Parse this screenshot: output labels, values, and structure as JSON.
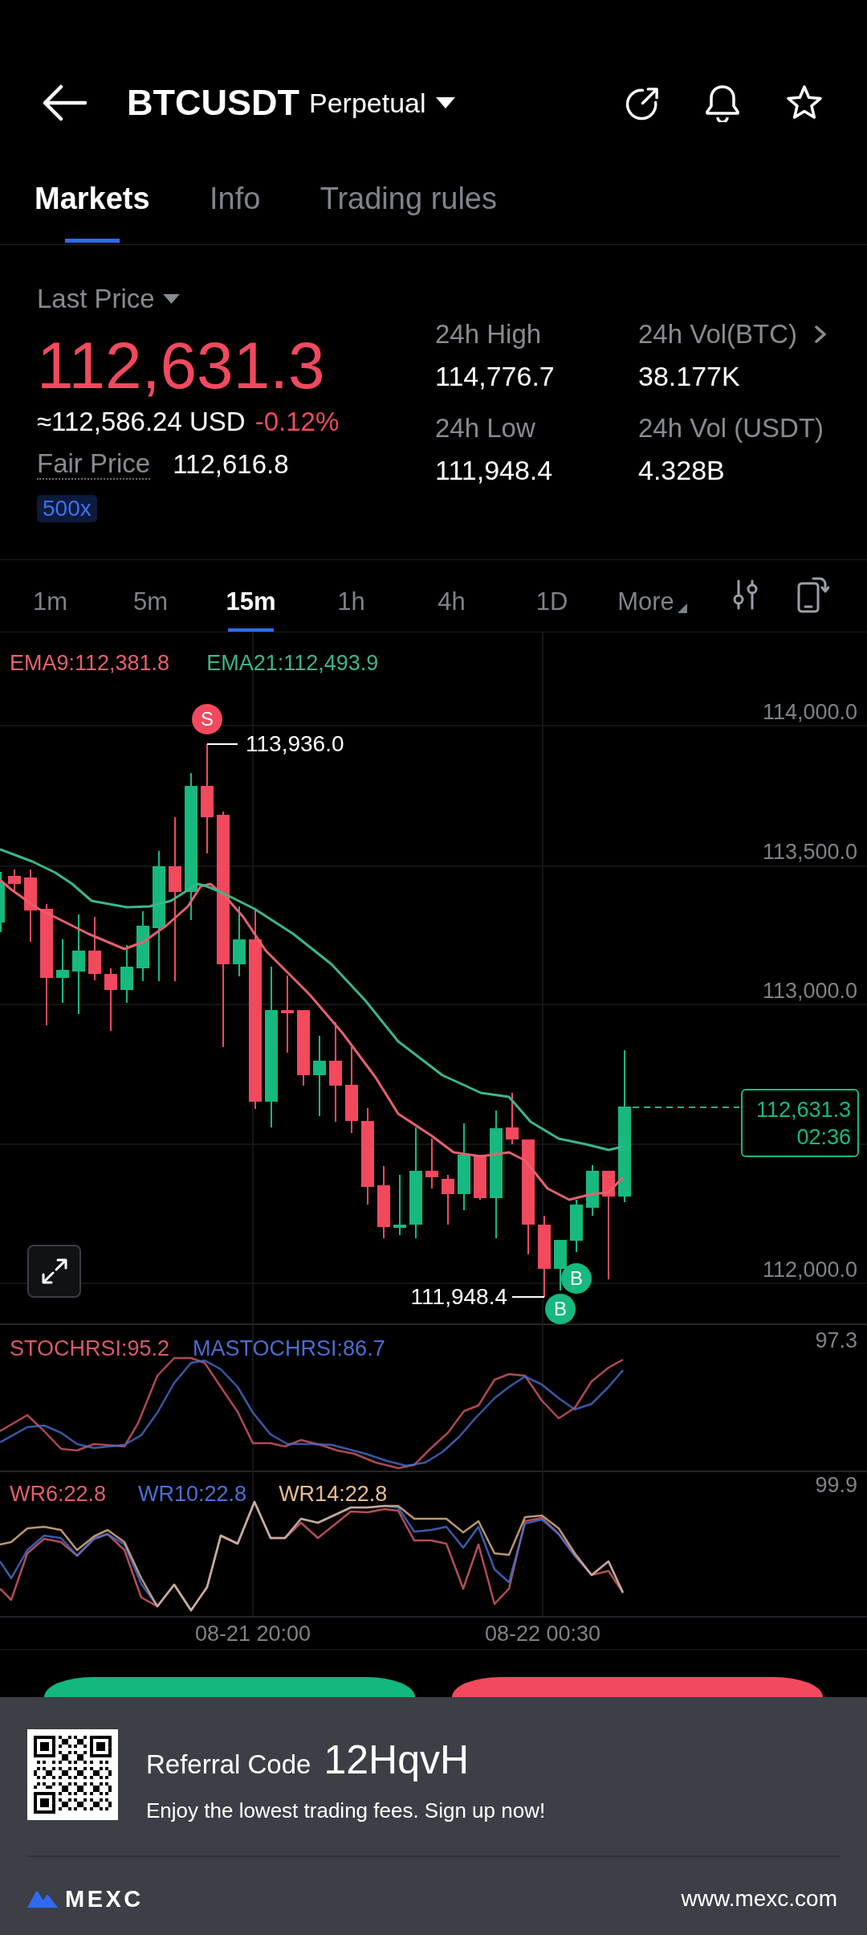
{
  "header": {
    "symbol": "BTCUSDT",
    "contract_type": "Perpetual"
  },
  "tabs": [
    {
      "label": "Markets",
      "selected": true
    },
    {
      "label": "Info",
      "selected": false
    },
    {
      "label": "Trading rules",
      "selected": false
    }
  ],
  "price_panel": {
    "price_type": "Last Price",
    "last_price": "112,631.3",
    "usd_value": "≈112,586.24 USD",
    "change": "-0.12%",
    "fair_price_label": "Fair Price",
    "fair_price": "112,616.8",
    "leverage": "500x"
  },
  "stats": [
    {
      "label": "24h High",
      "value": "114,776.7"
    },
    {
      "label": "24h Vol(BTC)",
      "value": "38.177K"
    },
    {
      "label": "24h Low",
      "value": "111,948.4"
    },
    {
      "label": "24h Vol (USDT)",
      "value": "4.328B"
    }
  ],
  "intervals": [
    {
      "label": "1m",
      "selected": false,
      "kind": "interval"
    },
    {
      "label": "5m",
      "selected": false,
      "kind": "interval"
    },
    {
      "label": "15m",
      "selected": true,
      "kind": "interval"
    },
    {
      "label": "1h",
      "selected": false,
      "kind": "interval"
    },
    {
      "label": "4h",
      "selected": false,
      "kind": "interval"
    },
    {
      "label": "1D",
      "selected": false,
      "kind": "interval"
    },
    {
      "label": "More",
      "selected": false,
      "kind": "menu"
    }
  ],
  "chart": {
    "legend": [
      {
        "label": "EMA9:112,381.8",
        "color": "#e5616c"
      },
      {
        "label": "EMA21:112,493.9",
        "color": "#3db68a"
      }
    ],
    "price_axis": [
      "114,000.0",
      "113,500.0",
      "113,000.0",
      "112,000.0"
    ],
    "high_label": "113,936.0",
    "low_label": "111,948.4",
    "signals": [
      {
        "label": "S",
        "kind": "sell"
      },
      {
        "label": "B",
        "kind": "buy"
      },
      {
        "label": "B",
        "kind": "buy"
      }
    ],
    "last_price": "112,631.3",
    "countdown": "02:36"
  },
  "indicators": [
    {
      "legend": [
        {
          "label": "STOCHRSI:95.2",
          "color": "#d95a66"
        },
        {
          "label": "MASTOCHRSI:86.7",
          "color": "#4a6ed0"
        }
      ],
      "axis_max": "97.3"
    },
    {
      "legend": [
        {
          "label": "WR6:22.8",
          "color": "#e0606a"
        },
        {
          "label": "WR10:22.8",
          "color": "#4a70d6"
        },
        {
          "label": "WR14:22.8",
          "color": "#eabd8c"
        }
      ],
      "axis_max": "99.9"
    }
  ],
  "time_axis": [
    "08-21 20:00",
    "08-22 00:30"
  ],
  "trade_buttons": [
    {
      "kind": "buy"
    },
    {
      "kind": "sell"
    }
  ],
  "referral": {
    "label": "Referral Code",
    "code": "12HqvH",
    "tagline": "Enjoy the lowest trading fees. Sign up now!",
    "brand": "MEXC",
    "website": "www.mexc.com"
  }
}
